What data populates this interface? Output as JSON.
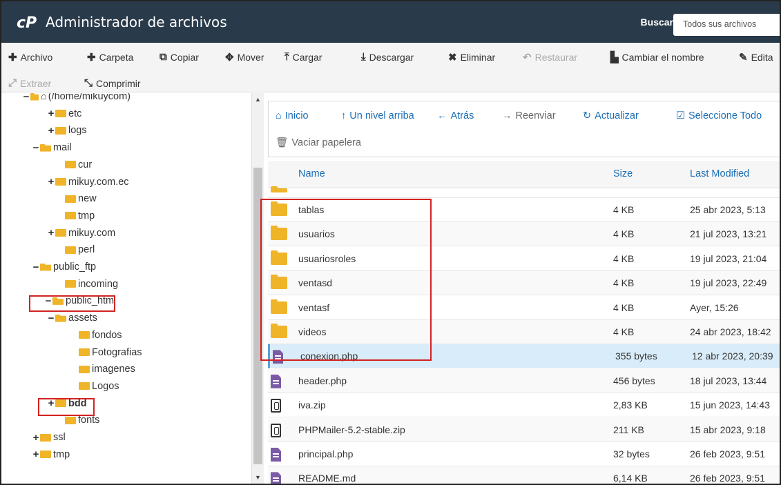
{
  "header": {
    "title": "Administrador de archivos",
    "search_label": "Buscar",
    "search_scope": "Todos sus archivos"
  },
  "toolbar": {
    "archivo": "Archivo",
    "carpeta": "Carpeta",
    "copiar": "Copiar",
    "mover": "Mover",
    "cargar": "Cargar",
    "descargar": "Descargar",
    "eliminar": "Eliminar",
    "restaurar": "Restaurar",
    "renombrar": "Cambiar el nombre",
    "editar": "Edita",
    "extraer": "Extraer",
    "comprimir": "Comprimir"
  },
  "tree": [
    {
      "label": "(/home/mikuycom)",
      "sign": "−"
    },
    {
      "label": "etc",
      "sign": "+"
    },
    {
      "label": "logs",
      "sign": "+"
    },
    {
      "label": "mail",
      "sign": "−"
    },
    {
      "label": "cur",
      "sign": ""
    },
    {
      "label": "mikuy.com.ec",
      "sign": "+"
    },
    {
      "label": "new",
      "sign": ""
    },
    {
      "label": "tmp",
      "sign": ""
    },
    {
      "label": "mikuy.com",
      "sign": "+"
    },
    {
      "label": "perl",
      "sign": ""
    },
    {
      "label": "public_ftp",
      "sign": "−"
    },
    {
      "label": "incoming",
      "sign": ""
    },
    {
      "label": "public_htm",
      "sign": "−"
    },
    {
      "label": "assets",
      "sign": "−"
    },
    {
      "label": "fondos",
      "sign": ""
    },
    {
      "label": "Fotografias",
      "sign": ""
    },
    {
      "label": "imagenes",
      "sign": ""
    },
    {
      "label": "Logos",
      "sign": ""
    },
    {
      "label": "bdd",
      "sign": "+"
    },
    {
      "label": "fonts",
      "sign": ""
    },
    {
      "label": "ssl",
      "sign": "+"
    },
    {
      "label": "tmp",
      "sign": "+"
    }
  ],
  "nav": {
    "inicio": "Inicio",
    "arriba": "Un nivel arriba",
    "atras": "Atrás",
    "reenviar": "Reenviar",
    "actualizar": "Actualizar",
    "seleccionar": "Seleccione Todo",
    "vaciar": "Vaciar papelera"
  },
  "columns": {
    "name": "Name",
    "size": "Size",
    "modified": "Last Modified"
  },
  "files": [
    {
      "name": "tablas",
      "size": "4 KB",
      "modified": "25 abr 2023, 5:13",
      "type": "folder"
    },
    {
      "name": "usuarios",
      "size": "4 KB",
      "modified": "21 jul 2023, 13:21",
      "type": "folder"
    },
    {
      "name": "usuariosroles",
      "size": "4 KB",
      "modified": "19 jul 2023, 21:04",
      "type": "folder"
    },
    {
      "name": "ventasd",
      "size": "4 KB",
      "modified": "19 jul 2023, 22:49",
      "type": "folder"
    },
    {
      "name": "ventasf",
      "size": "4 KB",
      "modified": "Ayer, 15:26",
      "type": "folder"
    },
    {
      "name": "videos",
      "size": "4 KB",
      "modified": "24 abr 2023, 18:42",
      "type": "folder"
    },
    {
      "name": "conexion.php",
      "size": "355 bytes",
      "modified": "12 abr 2023, 20:39",
      "type": "php"
    },
    {
      "name": "header.php",
      "size": "456 bytes",
      "modified": "18 jul 2023, 13:44",
      "type": "php"
    },
    {
      "name": "iva.zip",
      "size": "2,83 KB",
      "modified": "15 jun 2023, 14:43",
      "type": "zip"
    },
    {
      "name": "PHPMailer-5.2-stable.zip",
      "size": "211 KB",
      "modified": "15 abr 2023, 9:18",
      "type": "zip"
    },
    {
      "name": "principal.php",
      "size": "32 bytes",
      "modified": "26 feb 2023, 9:51",
      "type": "php"
    },
    {
      "name": "README.md",
      "size": "6,14 KB",
      "modified": "26 feb 2023, 9:51",
      "type": "php"
    }
  ]
}
